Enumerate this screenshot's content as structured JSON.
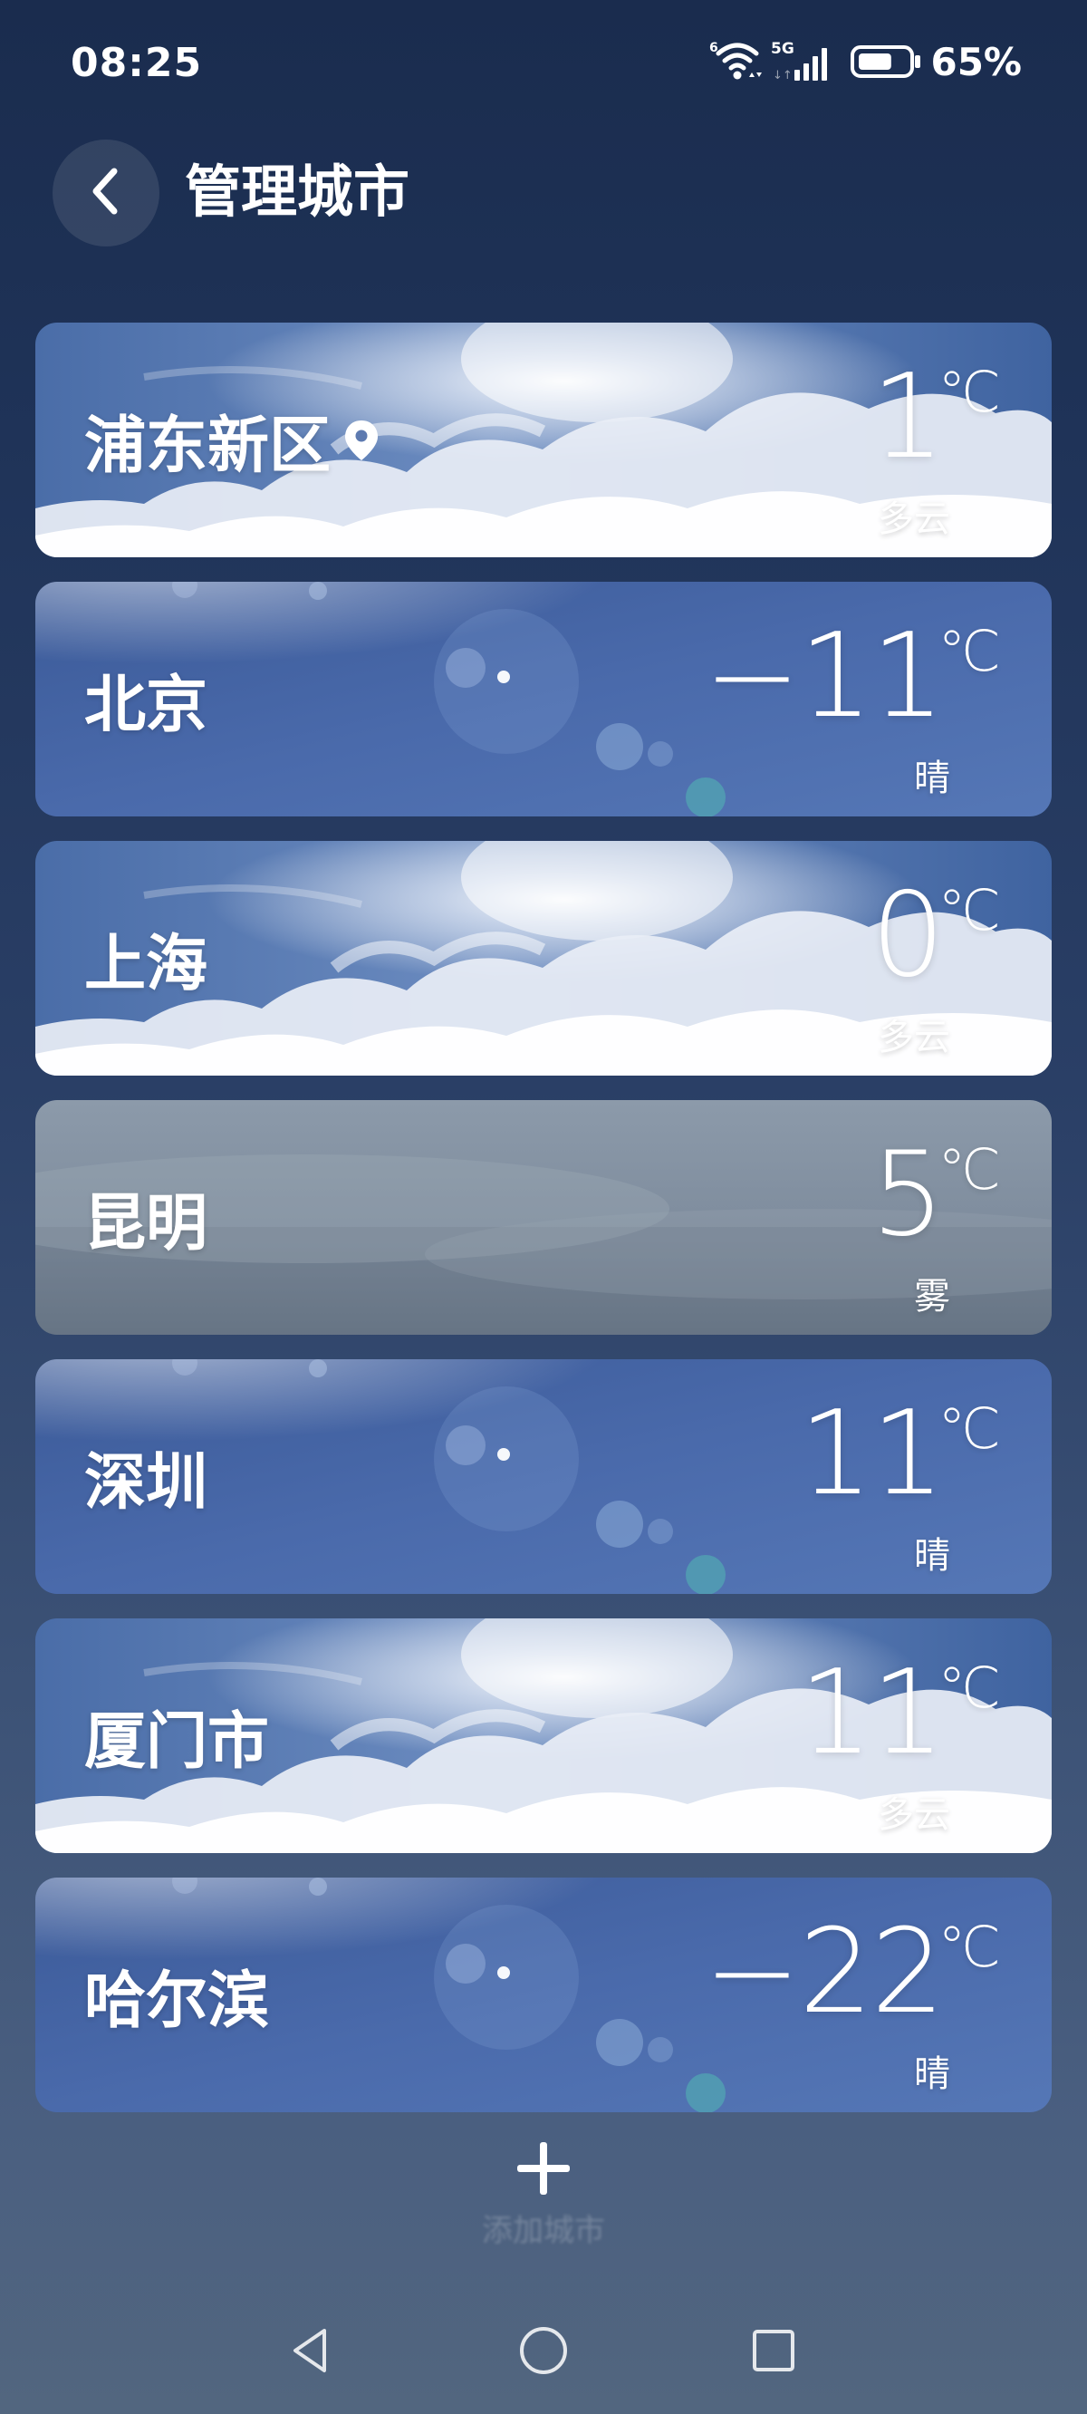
{
  "status_bar": {
    "time": "08:25",
    "wifi_badge": "6",
    "network": "5G",
    "battery_percent": "65%",
    "battery_level": 0.65
  },
  "header": {
    "back_icon": "chevron-left-icon",
    "title": "管理城市"
  },
  "cities": [
    {
      "name": "浦东新区",
      "temp": "1",
      "unit": "℃",
      "condition": "多云",
      "background": "cloudy",
      "current_location": true
    },
    {
      "name": "北京",
      "temp": "−11",
      "unit": "℃",
      "condition": "晴",
      "background": "sunny",
      "current_location": false
    },
    {
      "name": "上海",
      "temp": "0",
      "unit": "℃",
      "condition": "多云",
      "background": "cloudy",
      "current_location": false
    },
    {
      "name": "昆明",
      "temp": "5",
      "unit": "℃",
      "condition": "雾",
      "background": "fog",
      "current_location": false
    },
    {
      "name": "深圳",
      "temp": "11",
      "unit": "℃",
      "condition": "晴",
      "background": "sunny",
      "current_location": false
    },
    {
      "name": "厦门市",
      "temp": "11",
      "unit": "℃",
      "condition": "多云",
      "background": "cloudy",
      "current_location": false
    },
    {
      "name": "哈尔滨",
      "temp": "−22",
      "unit": "℃",
      "condition": "晴",
      "background": "sunny",
      "current_location": false
    }
  ],
  "add_city": {
    "icon": "plus-icon",
    "label": "添加城市"
  },
  "nav_bar": {
    "icons": [
      "back-triangle-icon",
      "home-circle-icon",
      "recents-square-icon"
    ]
  }
}
